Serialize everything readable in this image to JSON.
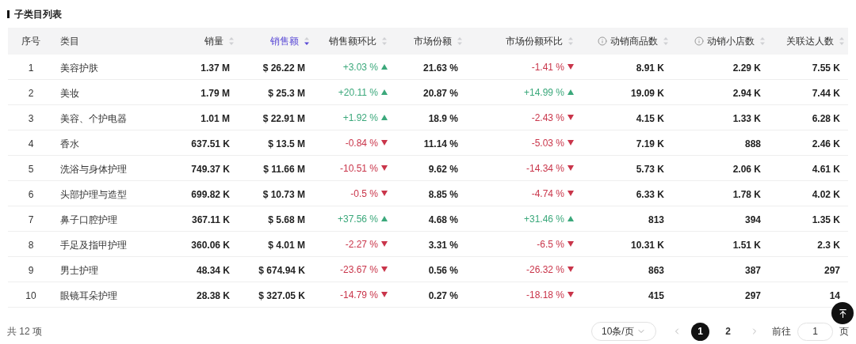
{
  "title": "子类目列表",
  "table": {
    "columns": [
      {
        "label": "序号",
        "sortable": false,
        "sorted": false,
        "info": false
      },
      {
        "label": "类目",
        "sortable": false,
        "sorted": false,
        "info": false
      },
      {
        "label": "销量",
        "sortable": true,
        "sorted": false,
        "info": false
      },
      {
        "label": "销售额",
        "sortable": true,
        "sorted": true,
        "info": false
      },
      {
        "label": "销售额环比",
        "sortable": true,
        "sorted": false,
        "info": false
      },
      {
        "label": "市场份额",
        "sortable": true,
        "sorted": false,
        "info": false
      },
      {
        "label": "市场份额环比",
        "sortable": true,
        "sorted": false,
        "info": false
      },
      {
        "label": "动销商品数",
        "sortable": true,
        "sorted": false,
        "info": true
      },
      {
        "label": "动销小店数",
        "sortable": true,
        "sorted": false,
        "info": true
      },
      {
        "label": "关联达人数",
        "sortable": true,
        "sorted": false,
        "info": false
      }
    ],
    "rows": [
      {
        "index": "1",
        "category": "美容护肤",
        "sales": "1.37 M",
        "revenue": "$ 26.22 M",
        "revenue_change": {
          "text": "+3.03 %",
          "kind": "up"
        },
        "share": "21.63 %",
        "share_change": {
          "text": "-1.41 %",
          "kind": "down"
        },
        "products": "8.91 K",
        "shops": "2.29 K",
        "creators": "7.55 K"
      },
      {
        "index": "2",
        "category": "美妆",
        "sales": "1.79 M",
        "revenue": "$ 25.3 M",
        "revenue_change": {
          "text": "+20.11 %",
          "kind": "up"
        },
        "share": "20.87 %",
        "share_change": {
          "text": "+14.99 %",
          "kind": "up"
        },
        "products": "19.09 K",
        "shops": "2.94 K",
        "creators": "7.44 K"
      },
      {
        "index": "3",
        "category": "美容、个护电器",
        "sales": "1.01 M",
        "revenue": "$ 22.91 M",
        "revenue_change": {
          "text": "+1.92 %",
          "kind": "up"
        },
        "share": "18.9 %",
        "share_change": {
          "text": "-2.43 %",
          "kind": "down"
        },
        "products": "4.15 K",
        "shops": "1.33 K",
        "creators": "6.28 K"
      },
      {
        "index": "4",
        "category": "香水",
        "sales": "637.51 K",
        "revenue": "$ 13.5 M",
        "revenue_change": {
          "text": "-0.84 %",
          "kind": "down"
        },
        "share": "11.14 %",
        "share_change": {
          "text": "-5.03 %",
          "kind": "down"
        },
        "products": "7.19 K",
        "shops": "888",
        "creators": "2.46 K"
      },
      {
        "index": "5",
        "category": "洗浴与身体护理",
        "sales": "749.37 K",
        "revenue": "$ 11.66 M",
        "revenue_change": {
          "text": "-10.51 %",
          "kind": "down"
        },
        "share": "9.62 %",
        "share_change": {
          "text": "-14.34 %",
          "kind": "down"
        },
        "products": "5.73 K",
        "shops": "2.06 K",
        "creators": "4.61 K"
      },
      {
        "index": "6",
        "category": "头部护理与造型",
        "sales": "699.82 K",
        "revenue": "$ 10.73 M",
        "revenue_change": {
          "text": "-0.5 %",
          "kind": "down"
        },
        "share": "8.85 %",
        "share_change": {
          "text": "-4.74 %",
          "kind": "down"
        },
        "products": "6.33 K",
        "shops": "1.78 K",
        "creators": "4.02 K"
      },
      {
        "index": "7",
        "category": "鼻子口腔护理",
        "sales": "367.11 K",
        "revenue": "$ 5.68 M",
        "revenue_change": {
          "text": "+37.56 %",
          "kind": "up"
        },
        "share": "4.68 %",
        "share_change": {
          "text": "+31.46 %",
          "kind": "up"
        },
        "products": "813",
        "shops": "394",
        "creators": "1.35 K"
      },
      {
        "index": "8",
        "category": "手足及指甲护理",
        "sales": "360.06 K",
        "revenue": "$ 4.01 M",
        "revenue_change": {
          "text": "-2.27 %",
          "kind": "down"
        },
        "share": "3.31 %",
        "share_change": {
          "text": "-6.5 %",
          "kind": "down"
        },
        "products": "10.31 K",
        "shops": "1.51 K",
        "creators": "2.3 K"
      },
      {
        "index": "9",
        "category": "男士护理",
        "sales": "48.34 K",
        "revenue": "$ 674.94 K",
        "revenue_change": {
          "text": "-23.67 %",
          "kind": "down"
        },
        "share": "0.56 %",
        "share_change": {
          "text": "-26.32 %",
          "kind": "down"
        },
        "products": "863",
        "shops": "387",
        "creators": "297"
      },
      {
        "index": "10",
        "category": "眼镜耳朵护理",
        "sales": "28.38 K",
        "revenue": "$ 327.05 K",
        "revenue_change": {
          "text": "-14.79 %",
          "kind": "down"
        },
        "share": "0.27 %",
        "share_change": {
          "text": "-18.18 %",
          "kind": "down"
        },
        "products": "415",
        "shops": "297",
        "creators": "14"
      }
    ]
  },
  "footer": {
    "total": "共 12 项",
    "page_size": "10条/页",
    "pages": [
      {
        "label": "1",
        "selected": true
      },
      {
        "label": "2",
        "selected": false
      }
    ],
    "goto_label": "前往",
    "goto_value": "1",
    "goto_suffix": "页"
  }
}
